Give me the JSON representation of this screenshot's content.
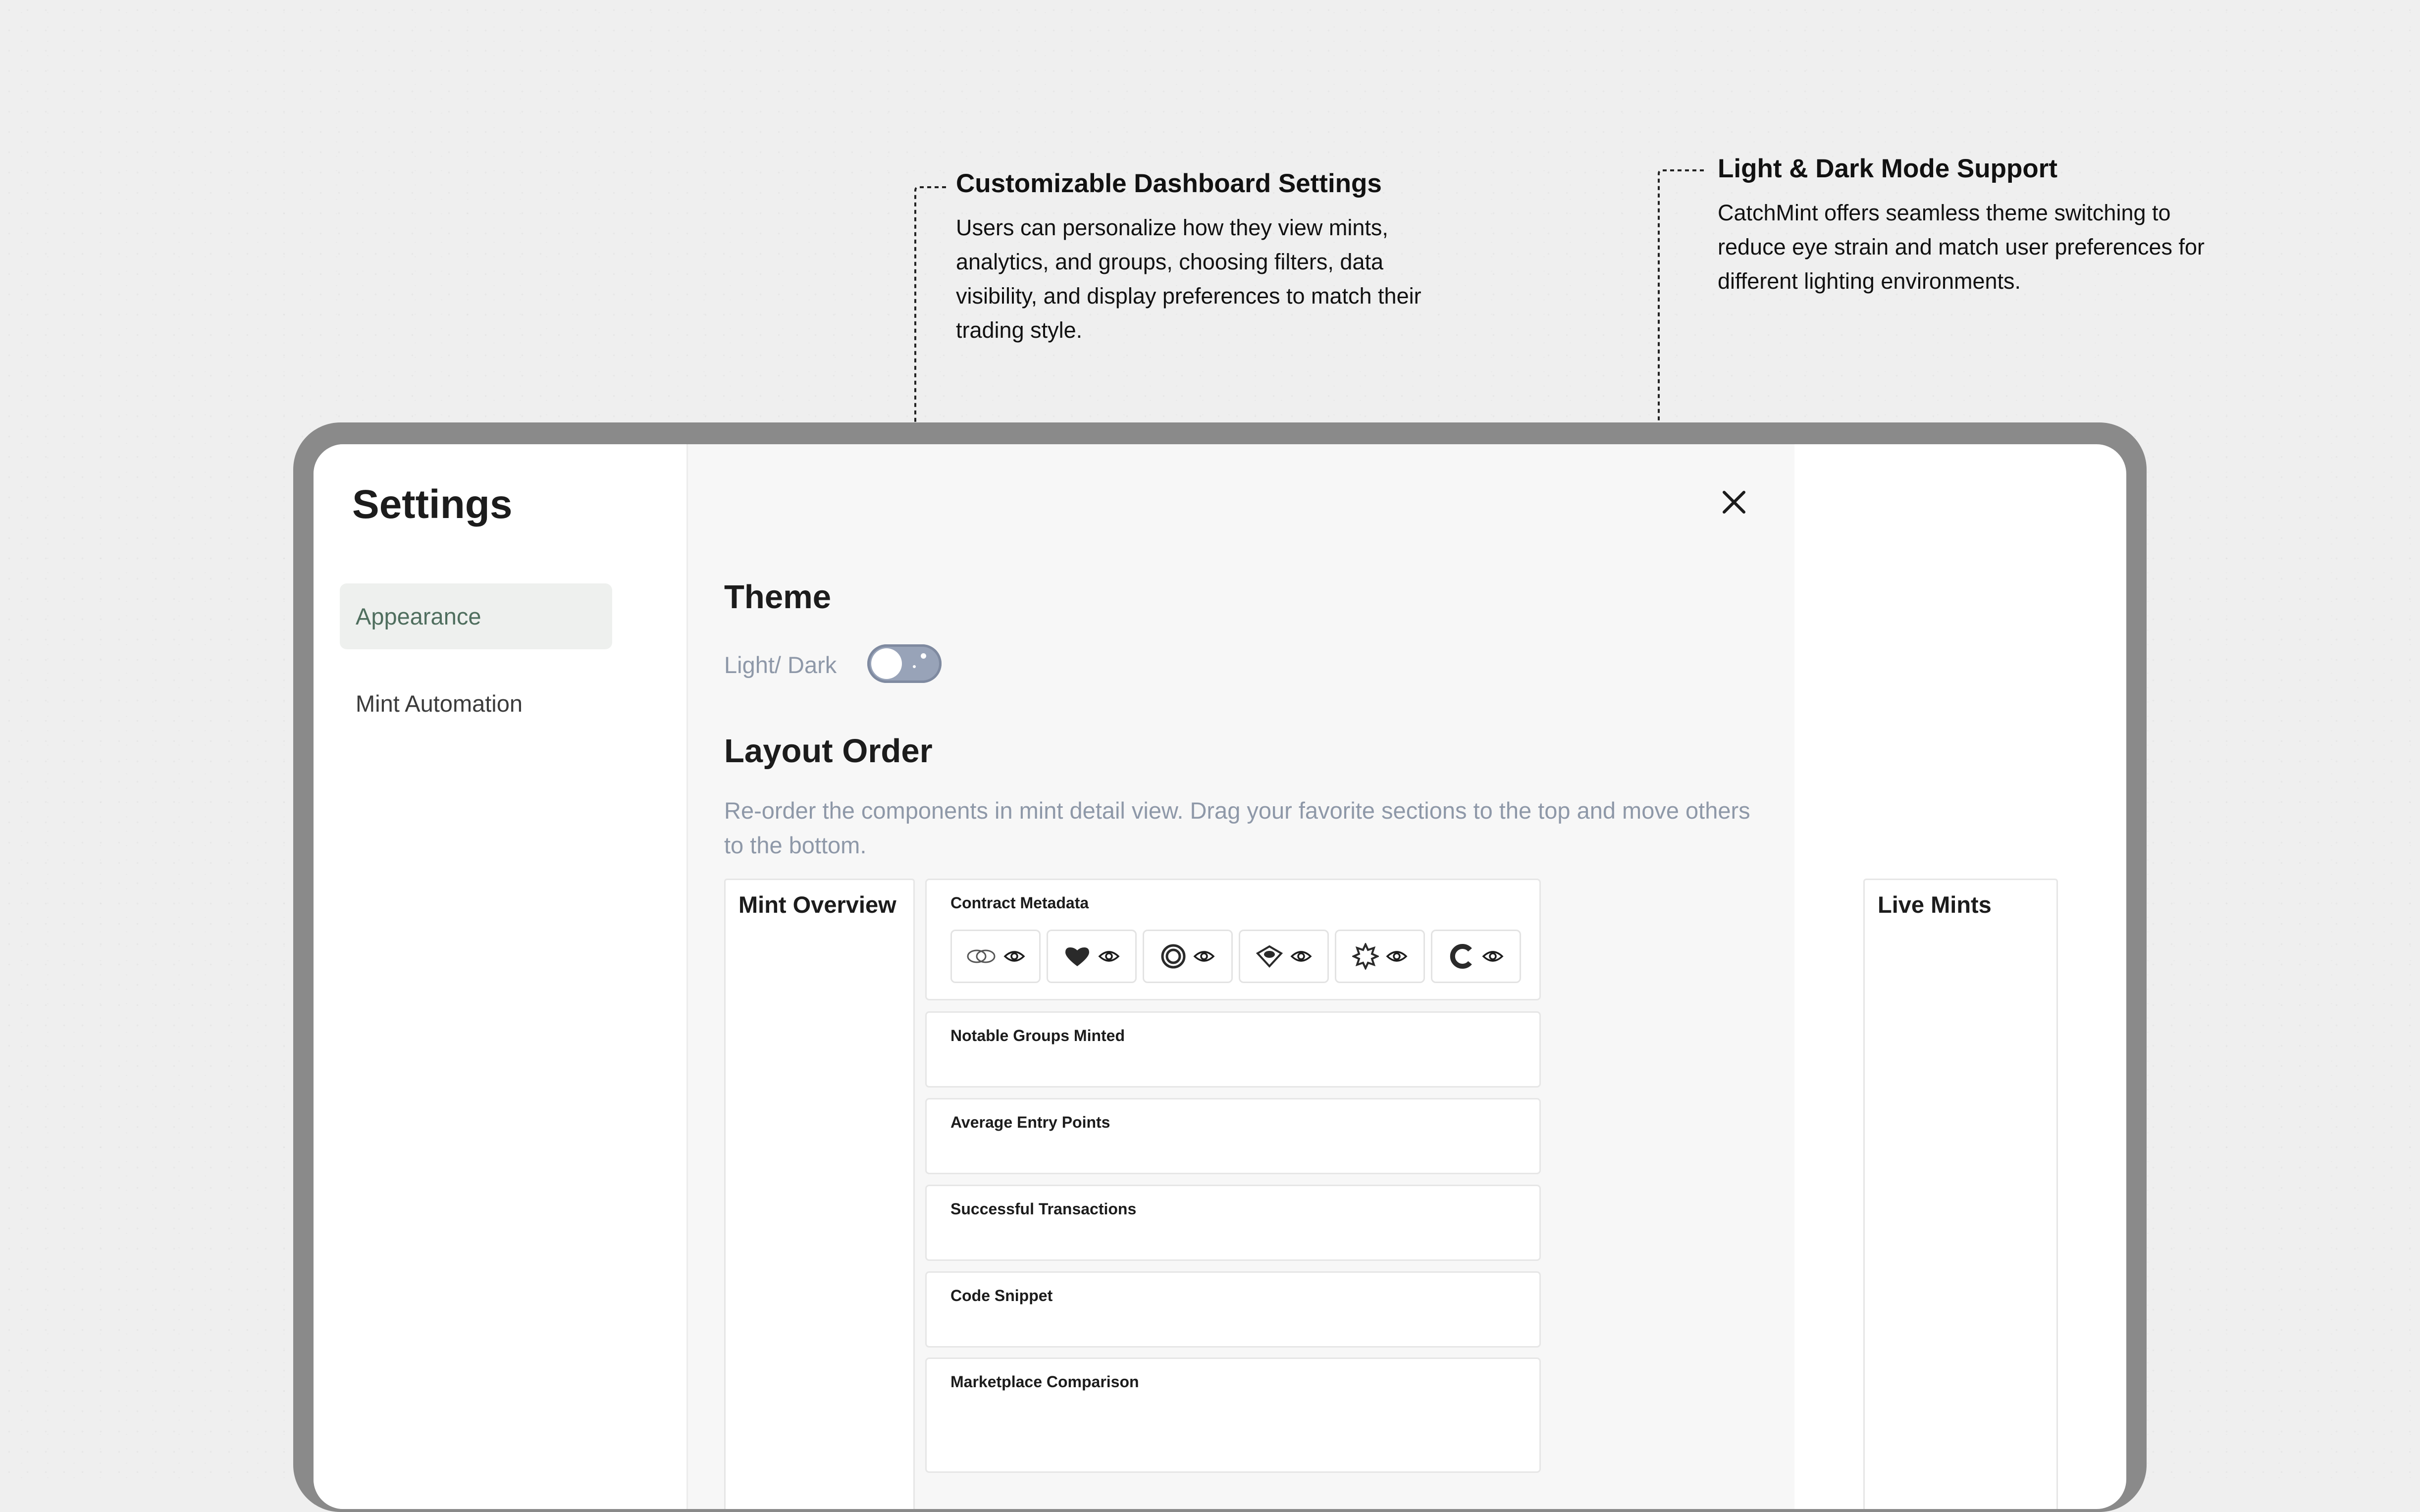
{
  "annotations": {
    "dashboard": {
      "title": "Customizable Dashboard Settings",
      "body": "Users can personalize how they view mints, analytics, and groups, choosing filters, data visibility, and display preferences to match their trading style."
    },
    "theme_mode": {
      "title": "Light & Dark Mode Support",
      "body": "CatchMint offers seamless theme switching to reduce eye strain and match user preferences for different lighting environments."
    }
  },
  "sidebar": {
    "title": "Settings",
    "items": [
      {
        "label": "Appearance",
        "active": true
      },
      {
        "label": "Mint Automation",
        "active": false
      }
    ]
  },
  "main": {
    "close_icon": "close-icon",
    "theme": {
      "title": "Theme",
      "toggle_label": "Light/ Dark",
      "toggle_state": "light"
    },
    "layout_order": {
      "title": "Layout Order",
      "description": "Re-order the components in mint detail view. Drag your favorite sections to the top and move others to the bottom.",
      "left_column": "Mint Overview",
      "right_column": "Live Mints",
      "cards": [
        {
          "title": "Contract Metadata"
        },
        {
          "title": "Notable Groups Minted"
        },
        {
          "title": "Average Entry Points"
        },
        {
          "title": "Successful Transactions"
        },
        {
          "title": "Code Snippet"
        },
        {
          "title": "Marketplace Comparison"
        }
      ],
      "metadata_icons": [
        "opensea-icon",
        "magic-eden-icon",
        "blur-icon",
        "looksrare-icon",
        "x2y2-icon",
        "coinbase-icon"
      ],
      "visibility_icon": "eye-icon"
    }
  },
  "colors": {
    "accent_green": "#4f6e5e",
    "muted_text": "#8e98a8",
    "toggle": "#98a3b8",
    "frame": "#8a8a8a"
  }
}
